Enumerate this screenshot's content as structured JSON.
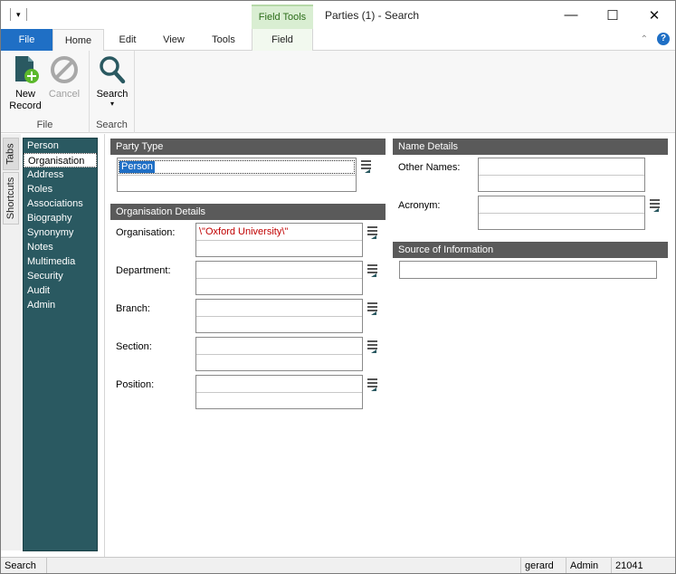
{
  "window": {
    "title": "Parties (1) - Search",
    "context_tab_group": "Field Tools",
    "minimize_glyph": "—",
    "maximize_glyph": "☐",
    "close_glyph": "✕"
  },
  "ribbon": {
    "tabs": [
      "File",
      "Home",
      "Edit",
      "View",
      "Tools",
      "Field"
    ],
    "help_glyph": "?",
    "groups": {
      "file": {
        "label": "File",
        "new_record": "New\nRecord",
        "cancel": "Cancel"
      },
      "search": {
        "label": "Search",
        "search": "Search"
      }
    }
  },
  "side_tabs": [
    "Tabs",
    "Shortcuts"
  ],
  "navigator": {
    "items": [
      "Person",
      "Organisation",
      "Address",
      "Roles",
      "Associations",
      "Biography",
      "Synonymy",
      "Notes",
      "Multimedia",
      "Security",
      "Audit",
      "Admin"
    ],
    "selected": "Organisation"
  },
  "party_type": {
    "header": "Party Type",
    "value": "Person"
  },
  "organisation_details": {
    "header": "Organisation Details",
    "organisation_label": "Organisation:",
    "organisation_value": "\\\"Oxford University\\\"",
    "department_label": "Department:",
    "branch_label": "Branch:",
    "section_label": "Section:",
    "position_label": "Position:"
  },
  "name_details": {
    "header": "Name Details",
    "other_names_label": "Other Names:",
    "acronym_label": "Acronym:"
  },
  "source_of_information": {
    "header": "Source of Information"
  },
  "status": {
    "mode": "Search",
    "user": "gerard",
    "role": "Admin",
    "number": "21041"
  },
  "colors": {
    "accent": "#1f6fc5",
    "navigator_bg": "#2a5961",
    "section_header": "#5a5a5a",
    "context_tab": "#d9eed2",
    "query_text": "#c00000"
  }
}
